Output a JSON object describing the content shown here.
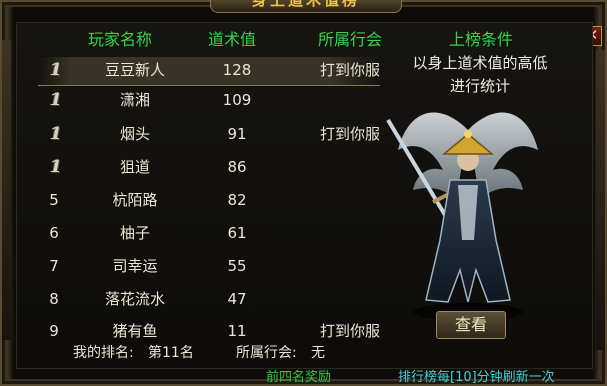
{
  "window": {
    "title": "身上道术值榜",
    "close_icon": "close-icon"
  },
  "table": {
    "headers": {
      "name": "玩家名称",
      "score": "道术值",
      "guild": "所属行会",
      "condition": "上榜条件"
    },
    "rows": [
      {
        "rank": "1",
        "medal": true,
        "name": "豆豆新人",
        "score": "128",
        "guild": "打到你服"
      },
      {
        "rank": "1",
        "medal": true,
        "name": "潇湘",
        "score": "109",
        "guild": ""
      },
      {
        "rank": "1",
        "medal": true,
        "name": "烟头",
        "score": "91",
        "guild": "打到你服"
      },
      {
        "rank": "1",
        "medal": true,
        "name": "狙道",
        "score": "86",
        "guild": ""
      },
      {
        "rank": "5",
        "medal": false,
        "name": "杭陌路",
        "score": "82",
        "guild": ""
      },
      {
        "rank": "6",
        "medal": false,
        "name": "柚子",
        "score": "61",
        "guild": ""
      },
      {
        "rank": "7",
        "medal": false,
        "name": "司幸运",
        "score": "55",
        "guild": ""
      },
      {
        "rank": "8",
        "medal": false,
        "name": "落花流水",
        "score": "47",
        "guild": ""
      },
      {
        "rank": "9",
        "medal": false,
        "name": "猪有鱼",
        "score": "11",
        "guild": "打到你服"
      }
    ]
  },
  "condition": {
    "line1": "以身上道术值的高低",
    "line2": "进行统计"
  },
  "view_button": {
    "label": "查看"
  },
  "my_rank": {
    "label": "我的排名:",
    "value": "第11名",
    "guild_label": "所属行会:",
    "guild_value": "无"
  },
  "footer": {
    "left": "前四名奖励",
    "right": "排行榜每[10]分钟刷新一次"
  },
  "colors": {
    "header_green": "#36d34a",
    "title_gold": "#f0c34a",
    "footer_cyan": "#3fd0d8"
  }
}
